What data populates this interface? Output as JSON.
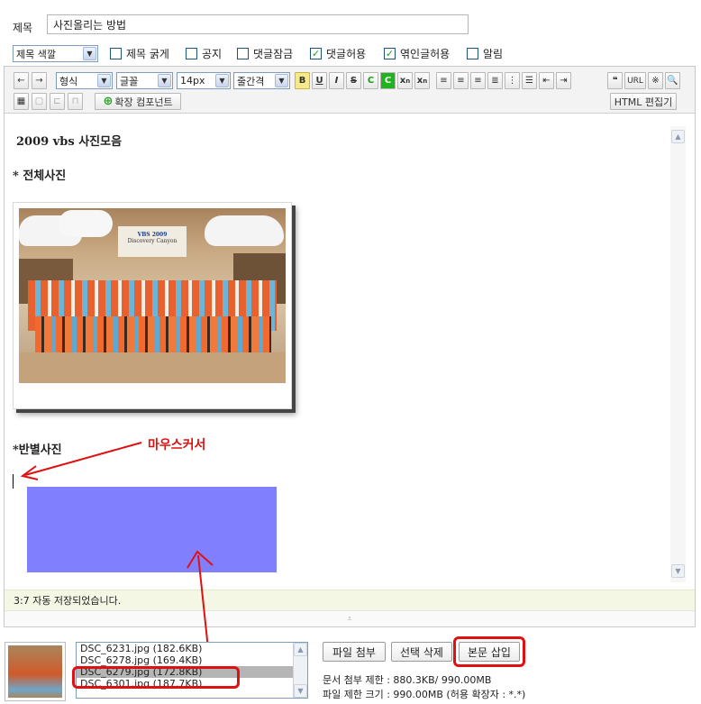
{
  "form": {
    "title_label": "제목",
    "title_value": "사진올리는 방법",
    "title_color_select": "제목 색깔",
    "options": [
      {
        "label": "제목 굵게",
        "checked": false
      },
      {
        "label": "공지",
        "checked": false
      },
      {
        "label": "댓글잠금",
        "checked": false
      },
      {
        "label": "댓글허용",
        "checked": true
      },
      {
        "label": "엮인글허용",
        "checked": true
      },
      {
        "label": "알림",
        "checked": false
      }
    ]
  },
  "toolbar": {
    "format_select": "형식",
    "font_select": "글꼴",
    "size_select": "14px",
    "line_select": "줄간격",
    "extend_component": "확장 컴포넌트",
    "html_editor": "HTML 편집기",
    "url_label": "URL"
  },
  "content": {
    "heading": "2009 vbs 사진모음",
    "section1": "* 전체사진",
    "photo_banner_line1": "VBS 2009",
    "photo_banner_line2": "Discovery Canyon",
    "section2": "*반별사진",
    "annotation": "마우스커서"
  },
  "status": {
    "autosave": "3:7 자동 저장되었습니다."
  },
  "attachments": {
    "files": [
      {
        "name": "DSC_6231.jpg (182.6KB)",
        "selected": false
      },
      {
        "name": "DSC_6278.jpg (169.4KB)",
        "selected": false
      },
      {
        "name": "DSC_6279.jpg (172.8KB)",
        "selected": true
      },
      {
        "name": "DSC_6301.jpg (187.7KB)",
        "selected": false
      }
    ],
    "attach_button": "파일 첨부",
    "delete_button": "선택 삭제",
    "insert_button": "본문 삽입",
    "doc_limit": "문서 첨부 제한 : 880.3KB/ 990.00MB",
    "file_limit": "파일 제한 크기 : 990.00MB (허용 확장자 : *.*)"
  },
  "colors": {
    "accent_red": "#e01010",
    "placeholder_blue": "#8080ff",
    "status_bg": "#f3f7e4"
  }
}
